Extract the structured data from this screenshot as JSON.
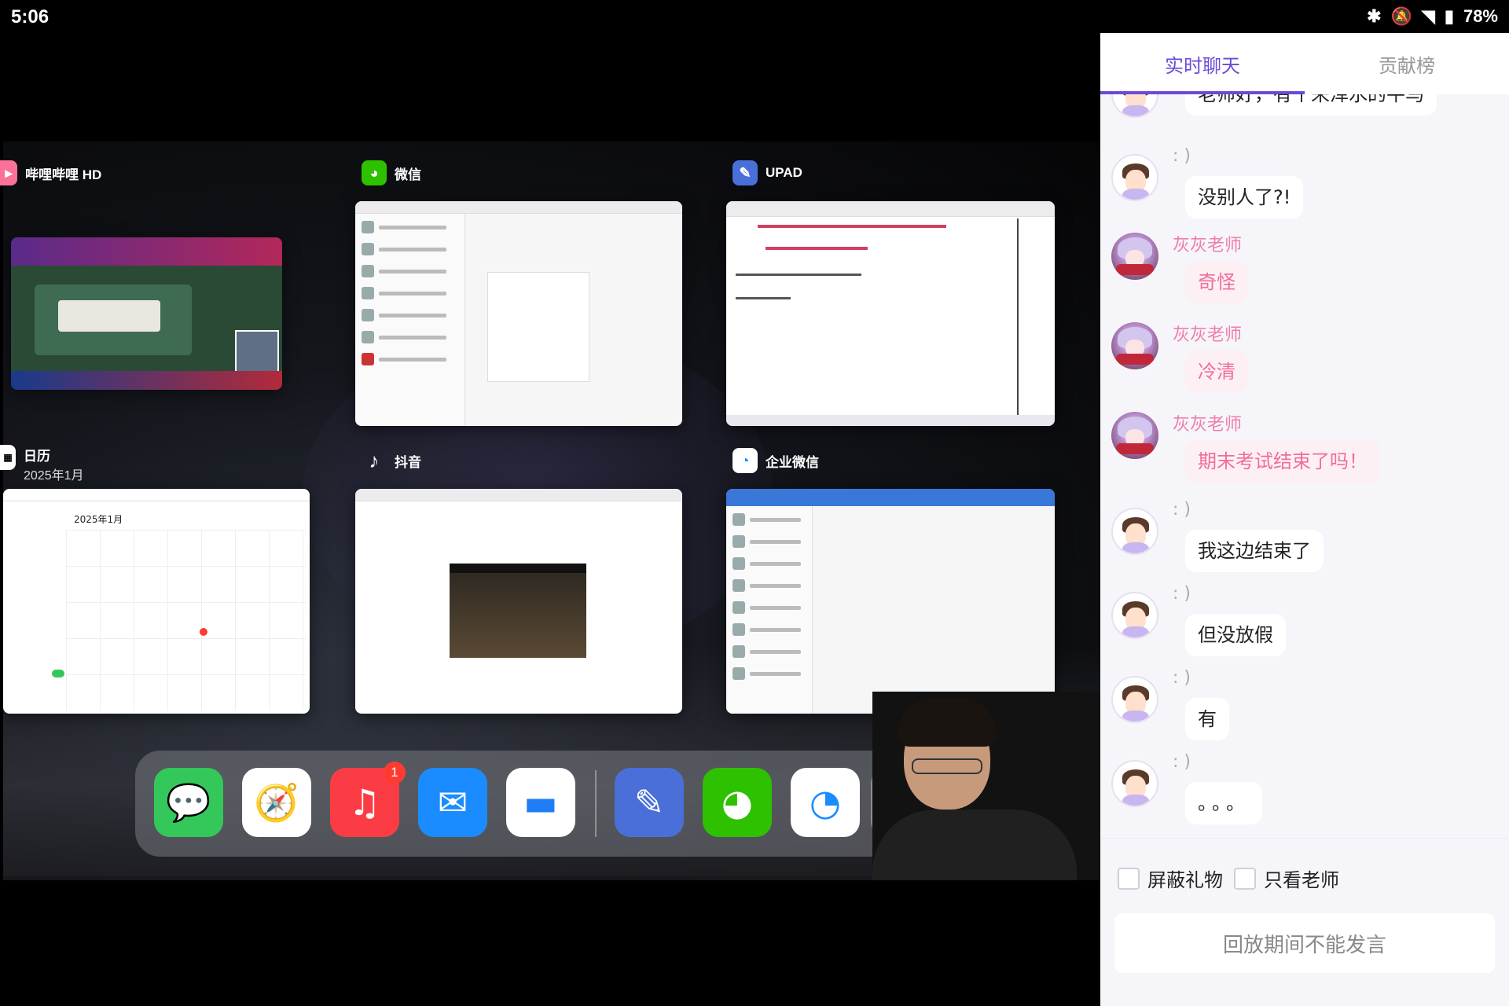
{
  "video": {
    "status_time": "5:06",
    "apps": [
      {
        "name": "哔哩哔哩 HD",
        "icon": "bilibili-icon"
      },
      {
        "name": "微信",
        "icon": "wechat-icon"
      },
      {
        "name": "UPAD",
        "icon": "upad-icon"
      },
      {
        "name": "日历",
        "sub": "2025年1月",
        "icon": "calendar-icon"
      },
      {
        "name": "抖音",
        "icon": "douyin-icon"
      },
      {
        "name": "企业微信",
        "icon": "wecom-icon"
      }
    ],
    "calendar_title": "2025年1月",
    "dock": [
      {
        "icon": "messages-icon",
        "color": "#34c759"
      },
      {
        "icon": "safari-icon",
        "color": "#1e88e5"
      },
      {
        "icon": "music-icon",
        "color": "#fc3c44",
        "badge": "1"
      },
      {
        "icon": "mail-icon",
        "color": "#1a8cff"
      },
      {
        "icon": "files-icon",
        "color": "#1f7ef5"
      },
      {
        "icon": "upad-icon",
        "color": "#4a6fd8"
      },
      {
        "icon": "wechat-icon",
        "color": "#2dc100"
      },
      {
        "icon": "wecom-icon",
        "color": "#ffffff"
      },
      {
        "icon": "camera-icon",
        "color": "#8e8e93"
      }
    ]
  },
  "system": {
    "battery": "78%"
  },
  "tabs": [
    {
      "label": "实时聊天",
      "active": true
    },
    {
      "label": "贡献榜",
      "active": false
    }
  ],
  "messages": [
    {
      "nick": "",
      "text": "老师好，有个来浑水的牛马",
      "role": "user"
    },
    {
      "nick": ": )",
      "text": "没别人了?!",
      "role": "user"
    },
    {
      "nick": "灰灰老师",
      "text": "奇怪",
      "role": "teacher"
    },
    {
      "nick": "灰灰老师",
      "text": "冷清",
      "role": "teacher"
    },
    {
      "nick": "灰灰老师",
      "text": "期末考试结束了吗！",
      "role": "teacher"
    },
    {
      "nick": ": )",
      "text": "我这边结束了",
      "role": "user"
    },
    {
      "nick": ": )",
      "text": "但没放假",
      "role": "user"
    },
    {
      "nick": ": )",
      "text": "有",
      "role": "user"
    },
    {
      "nick": ": )",
      "text": "。。。",
      "role": "user"
    }
  ],
  "footer": {
    "block_gifts": "屏蔽礼物",
    "only_teacher": "只看老师",
    "input_placeholder": "回放期间不能发言"
  }
}
